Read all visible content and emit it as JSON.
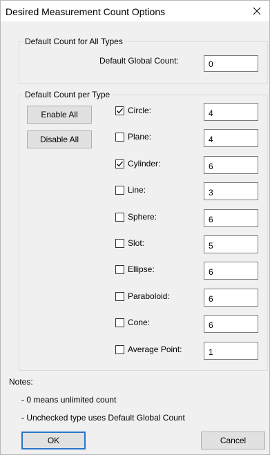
{
  "window": {
    "title": "Desired Measurement Count Options",
    "close_glyph": "✕"
  },
  "global_group": {
    "label": "Default Count for All Types",
    "field_label": "Default Global Count:",
    "value": "0"
  },
  "type_group": {
    "label": "Default Count per Type",
    "enable_all_label": "Enable All",
    "disable_all_label": "Disable All",
    "types": [
      {
        "name": "Circle:",
        "checked": true,
        "value": "4"
      },
      {
        "name": "Plane:",
        "checked": false,
        "value": "4"
      },
      {
        "name": "Cylinder:",
        "checked": true,
        "value": "6"
      },
      {
        "name": "Line:",
        "checked": false,
        "value": "3"
      },
      {
        "name": "Sphere:",
        "checked": false,
        "value": "6"
      },
      {
        "name": "Slot:",
        "checked": false,
        "value": "5"
      },
      {
        "name": "Ellipse:",
        "checked": false,
        "value": "6"
      },
      {
        "name": "Paraboloid:",
        "checked": false,
        "value": "6"
      },
      {
        "name": "Cone:",
        "checked": false,
        "value": "6"
      },
      {
        "name": "Average Point:",
        "checked": false,
        "value": "1"
      }
    ]
  },
  "notes": {
    "heading": "Notes:",
    "line1": "- 0 means unlimited count",
    "line2": "- Unchecked type uses Default Global Count"
  },
  "footer": {
    "ok_label": "OK",
    "cancel_label": "Cancel"
  }
}
